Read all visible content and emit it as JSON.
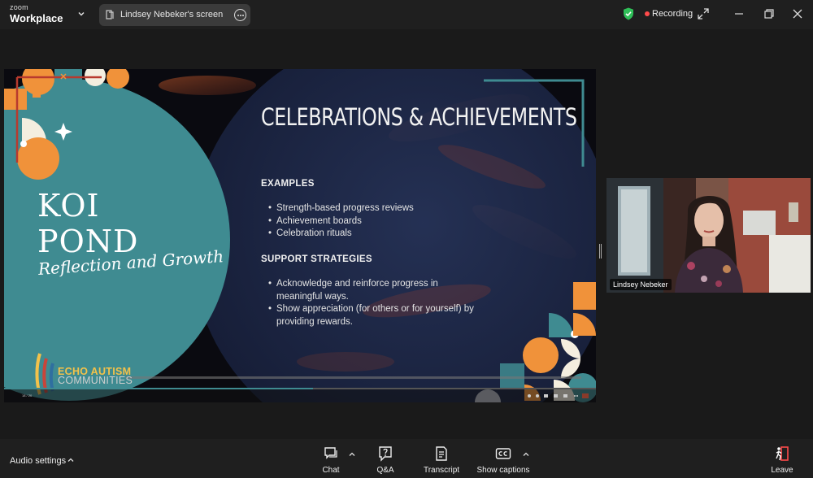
{
  "topbar": {
    "brand_line1": "zoom",
    "brand_line2": "Workplace",
    "share_label": "Lindsey Nebeker's screen",
    "recording_label": "Recording"
  },
  "slide": {
    "title": "CELEBRATIONS & ACHIEVEMENTS",
    "left_title_line1": "KOI",
    "left_title_line2": "POND",
    "left_subtitle": "Reflection and Growth",
    "examples_heading": "EXAMPLES",
    "examples": [
      "Strength-based progress reviews",
      "Achievement boards",
      "Celebration rituals"
    ],
    "support_heading": "SUPPORT STRATEGIES",
    "support": [
      "Acknowledge and reinforce progress in meaningful ways.",
      "Show appreciation (for others or for yourself) by providing rewards."
    ],
    "logo_line1": "ECHO AUTISM",
    "logo_line2": "COMMUNITIES",
    "page_indicator": "18 / 20",
    "colors": {
      "teal": "#3f8b91",
      "navy": "#1f2a4d",
      "orange": "#f0923a",
      "red": "#b83a2e",
      "cream": "#f4eedf"
    }
  },
  "participant": {
    "name": "Lindsey Nebeker"
  },
  "bottombar": {
    "audio_settings": "Audio settings",
    "buttons": [
      {
        "label": "Chat",
        "icon": "chat-icon"
      },
      {
        "label": "Q&A",
        "icon": "qa-icon"
      },
      {
        "label": "Transcript",
        "icon": "transcript-icon"
      },
      {
        "label": "Show captions",
        "icon": "cc-icon"
      },
      {
        "label": "Leave",
        "icon": "leave-icon"
      }
    ]
  }
}
